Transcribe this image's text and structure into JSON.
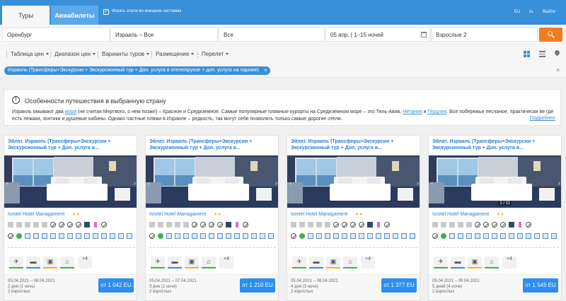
{
  "tabs": [
    {
      "label": "Туры",
      "active": true
    },
    {
      "label": "Авиабилеты",
      "active": false
    }
  ],
  "external_search": {
    "checked": true,
    "label": "Искать отели во внешних системах"
  },
  "languages": [
    "EU",
    "ru",
    "Выйти"
  ],
  "search": {
    "origin": "Оренбург",
    "destination": "Израиль – Все",
    "resort": "Все",
    "dates": "05 апр. | 1–15 ночей",
    "travelers": "Взрослые 2"
  },
  "filters": [
    "Таблица цен",
    "Диапазон цен",
    "Варианты туров",
    "Размещение",
    "Перелет"
  ],
  "chip": {
    "label": "Израиль (Трансферы+Экскурсии + Экскурсионный тур + Доп. услуга в отеле/круизе + доп. услуга на пароме)"
  },
  "info": {
    "title": "Особенности путешествия в выбранную страну",
    "text_1": "Израиль омывают два ",
    "link_1": "моря",
    "text_2": " (не считая Мертвого, о нем позже) – Красное и Средиземное. Самые популярные пляжные курорты на Средиземном море – это Тель-Авив, ",
    "link_2": "Нетания",
    "text_3": " и ",
    "link_3": "Герцлия",
    "text_4": ". Все побережье песчаное, практически ве где есть лежаки, зонтики и душевые кабины. Однако частные пляжи в Израиле – редкость, так могут себе позволить только самые дорогие отели.",
    "more": "Подробнее"
  },
  "cards": [
    {
      "title": "Эйлат. Израиль (Трансферы+Экскурсии + Экскурсионный тур + Доп. услуга в...",
      "hotel": "Isrotel Hotel Managament",
      "stars": "★★",
      "dates": "05.04.2021 – 06.04.2021",
      "nights": "2 дня (1 ночь)",
      "adults": "2 взрослых",
      "price": "от 1 042 EU",
      "more_services": "+4",
      "photo_counter": ""
    },
    {
      "title": "Эйлат. Израиль (Трансферы+Экскурсии + Экскурсионный тур + Доп. услуга в...",
      "hotel": "Isrotel Hotel Managament",
      "stars": "★★",
      "dates": "05.04.2021 – 07.04.2021",
      "nights": "3 дня (2 ночи)",
      "adults": "2 взрослых",
      "price": "от 1 210 EU",
      "more_services": "+4",
      "photo_counter": ""
    },
    {
      "title": "Эйлат. Израиль (Трансферы+Экскурсии + Экскурсионный тур + Доп. услуга в...",
      "hotel": "Isrotel Hotel Managament",
      "stars": "★★",
      "dates": "05.04.2021 – 08.04.2021",
      "nights": "4 дня (3 ночи)",
      "adults": "2 взрослых",
      "price": "от 1 377 EU",
      "more_services": "+4",
      "photo_counter": ""
    },
    {
      "title": "Эйлат. Израиль (Трансферы+Экскурсии + Экскурсионный тур + Доп. услуга в...",
      "hotel": "Isrotel Hotel Managament",
      "stars": "★★",
      "dates": "05.04.2021 – 09.04.2021",
      "nights": "5 дней (4 ночи)",
      "adults": "2 взрослых",
      "price": "от 1 545 EU",
      "more_services": "+4",
      "photo_counter": "1 / 11"
    }
  ],
  "colors": {
    "brand_blue": "#3a8fd9",
    "search_orange": "#f47a20",
    "price_button": "#2b8ef0",
    "star": "#f2b21a",
    "service_bars": [
      "#3fb24b",
      "#2b8ef0",
      "#f2b21a",
      "#3fb24b"
    ]
  }
}
